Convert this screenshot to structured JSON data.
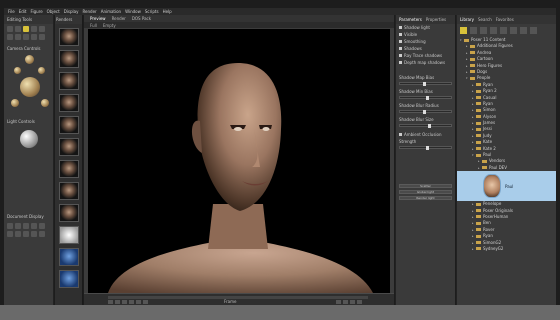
{
  "menu": [
    "File",
    "Edit",
    "Figure",
    "Object",
    "Display",
    "Render",
    "Animation",
    "Window",
    "Scripts",
    "Help"
  ],
  "left_panel": {
    "editing_tools_title": "Editing Tools",
    "camera_controls_title": "Camera Controls",
    "light_controls_title": "Light Controls",
    "document_display_title": "Document Display"
  },
  "thumb_strip_title": "Renders",
  "viewport": {
    "tabs": [
      "Preview",
      "Render",
      "DOS Pack"
    ],
    "toolbar": [
      "Full",
      "Empty"
    ],
    "frame_label": "Frame"
  },
  "params": {
    "tabs": [
      "Parameters",
      "Properties"
    ],
    "options": [
      "Shadow light",
      "Visible",
      "Smoothing",
      "Shadows",
      "Ray Trace shadows",
      "Depth map shadows"
    ],
    "sliders": [
      "Shadow Map Bias",
      "Shadow Min Bias",
      "Shadow Blur Radius",
      "Shadow Blur Size"
    ],
    "ambient_label": "Ambient Occlusion",
    "strength_label": "Strength",
    "buttons": [
      "Scatter",
      "Global light",
      "Render light"
    ]
  },
  "content": {
    "tabs": [
      "Library",
      "Search",
      "Favorites"
    ],
    "root": "Poser 11 Content",
    "items": [
      {
        "label": "Additional Figures",
        "indent": 1
      },
      {
        "label": "Andrea",
        "indent": 1
      },
      {
        "label": "Cartoon",
        "indent": 1
      },
      {
        "label": "Hero Figures",
        "indent": 1
      },
      {
        "label": "Dogs",
        "indent": 1
      },
      {
        "label": "People",
        "indent": 1,
        "open": true
      },
      {
        "label": "Ryan",
        "indent": 2
      },
      {
        "label": "Ryan 2",
        "indent": 2
      },
      {
        "label": "Casual",
        "indent": 2
      },
      {
        "label": "Ryan",
        "indent": 2
      },
      {
        "label": "Simon",
        "indent": 2
      },
      {
        "label": "Alyson",
        "indent": 2
      },
      {
        "label": "James",
        "indent": 2
      },
      {
        "label": "Jessi",
        "indent": 2
      },
      {
        "label": "Judy",
        "indent": 2
      },
      {
        "label": "Kate",
        "indent": 2
      },
      {
        "label": "Kate 2",
        "indent": 2
      },
      {
        "label": "Paul",
        "indent": 2,
        "open": true
      },
      {
        "label": "Vendors",
        "indent": 3
      },
      {
        "label": "Paul DEV",
        "indent": 3
      }
    ],
    "selected_label": "Paul",
    "items_after": [
      {
        "label": "Penelope",
        "indent": 2
      },
      {
        "label": "Poser Originals",
        "indent": 2
      },
      {
        "label": "PoserHuman",
        "indent": 2
      },
      {
        "label": "Ben",
        "indent": 2
      },
      {
        "label": "Rover",
        "indent": 2
      },
      {
        "label": "Ryan",
        "indent": 2
      },
      {
        "label": "SimonG2",
        "indent": 2
      },
      {
        "label": "SydneyG2",
        "indent": 2
      }
    ]
  }
}
